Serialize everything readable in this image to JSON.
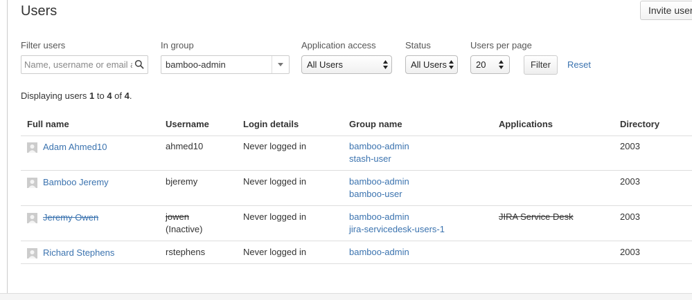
{
  "page": {
    "title": "Users",
    "invite_label": "Invite users"
  },
  "filters": {
    "filter_users_label": "Filter users",
    "search_placeholder": "Name, username or email address",
    "group_label": "In group",
    "group_value": "bamboo-admin",
    "app_access_label": "Application access",
    "app_access_value": "All Users",
    "status_label": "Status",
    "status_value": "All Users",
    "per_page_label": "Users per page",
    "per_page_value": "20",
    "filter_button": "Filter",
    "reset_link": "Reset"
  },
  "summary": {
    "prefix": "Displaying users ",
    "start": "1",
    "to": " to ",
    "end": "4",
    "of": " of ",
    "total": "4",
    "suffix": "."
  },
  "table": {
    "headers": {
      "full_name": "Full name",
      "username": "Username",
      "login_details": "Login details",
      "group_name": "Group name",
      "applications": "Applications",
      "directory": "Directory"
    },
    "rows": [
      {
        "full_name": "Adam Ahmed10",
        "username": "ahmed10",
        "status_note": "",
        "login": "Never logged in",
        "groups": [
          "bamboo-admin",
          "stash-user"
        ],
        "applications": "",
        "directory": "2003",
        "inactive": false
      },
      {
        "full_name": "Bamboo Jeremy",
        "username": "bjeremy",
        "status_note": "",
        "login": "Never logged in",
        "groups": [
          "bamboo-admin",
          "bamboo-user"
        ],
        "applications": "",
        "directory": "2003",
        "inactive": false
      },
      {
        "full_name": "Jeremy Owen",
        "username": "jowen",
        "status_note": "(Inactive)",
        "login": "Never logged in",
        "groups": [
          "bamboo-admin",
          "jira-servicedesk-users-1"
        ],
        "applications": "JIRA Service Desk",
        "directory": "2003",
        "inactive": true
      },
      {
        "full_name": "Richard Stephens",
        "username": "rstephens",
        "status_note": "",
        "login": "Never logged in",
        "groups": [
          "bamboo-admin"
        ],
        "applications": "",
        "directory": "2003",
        "inactive": false
      }
    ]
  },
  "colors": {
    "link": "#3b73af",
    "text": "#333333",
    "border": "#dddddd"
  },
  "icons": {
    "search": "search-icon",
    "avatar": "user-avatar-icon",
    "dropdown": "chevron-down-icon",
    "spinner": "up-down-arrows-icon"
  }
}
